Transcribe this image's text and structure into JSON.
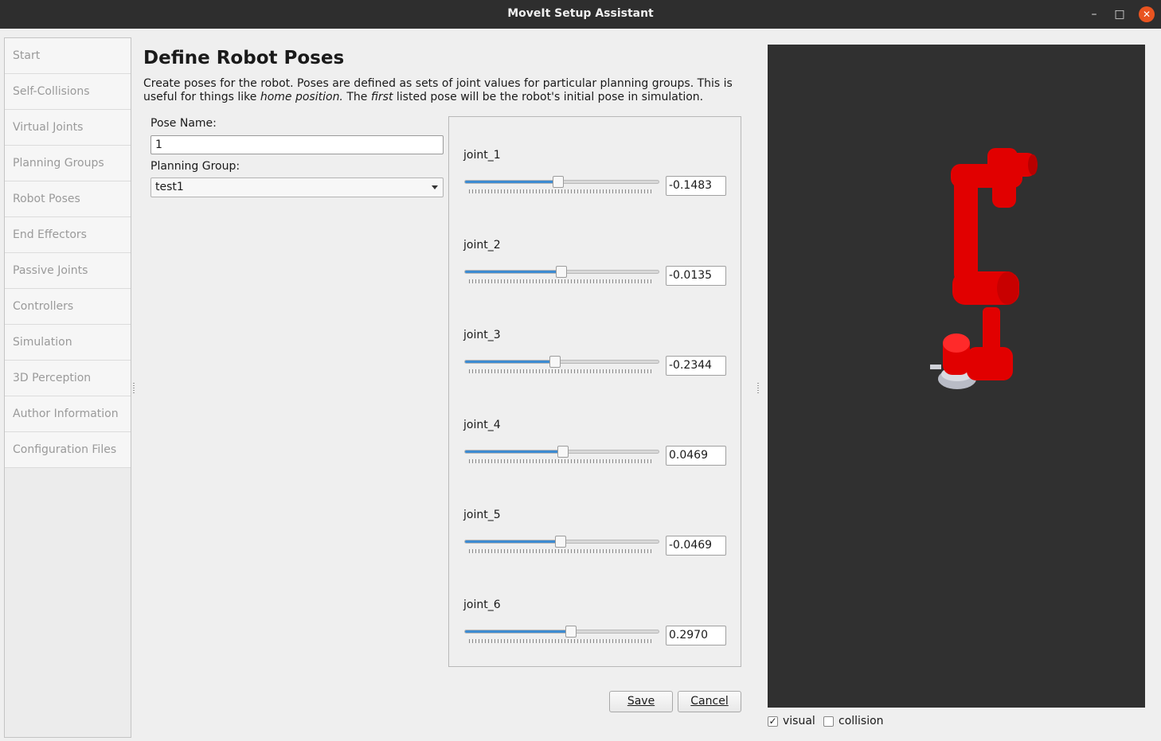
{
  "window": {
    "title": "MoveIt Setup Assistant",
    "min_glyph": "–",
    "max_glyph": "□",
    "close_glyph": "✕"
  },
  "sidebar": {
    "items": [
      {
        "label": "Start"
      },
      {
        "label": "Self-Collisions"
      },
      {
        "label": "Virtual Joints"
      },
      {
        "label": "Planning Groups"
      },
      {
        "label": "Robot Poses"
      },
      {
        "label": "End Effectors"
      },
      {
        "label": "Passive Joints"
      },
      {
        "label": "Controllers"
      },
      {
        "label": "Simulation"
      },
      {
        "label": "3D Perception"
      },
      {
        "label": "Author Information"
      },
      {
        "label": "Configuration Files"
      }
    ]
  },
  "main": {
    "title": "Define Robot Poses",
    "description_1": "Create poses for the robot. Poses are defined as sets of joint values for particular planning groups. This is useful for things like ",
    "description_em1": "home position.",
    "description_2": " The ",
    "description_em2": "first",
    "description_3": " listed pose will be the robot's initial pose in simulation.",
    "pose_name_label": "Pose Name:",
    "pose_name_value": "1",
    "planning_group_label": "Planning Group:",
    "planning_group_value": "test1"
  },
  "joints": [
    {
      "name": "joint_1",
      "value": "-0.1483",
      "slider_fraction": 0.48
    },
    {
      "name": "joint_2",
      "value": "-0.0135",
      "slider_fraction": 0.498
    },
    {
      "name": "joint_3",
      "value": "-0.2344",
      "slider_fraction": 0.465
    },
    {
      "name": "joint_4",
      "value": "0.0469",
      "slider_fraction": 0.506
    },
    {
      "name": "joint_5",
      "value": "-0.0469",
      "slider_fraction": 0.494
    },
    {
      "name": "joint_6",
      "value": "0.2970",
      "slider_fraction": 0.548
    }
  ],
  "buttons": {
    "save": "Save",
    "cancel": "Cancel"
  },
  "viewer": {
    "visual_label": "visual",
    "visual_checked": true,
    "collision_label": "collision",
    "collision_checked": false,
    "robot_color": "#e10000"
  }
}
